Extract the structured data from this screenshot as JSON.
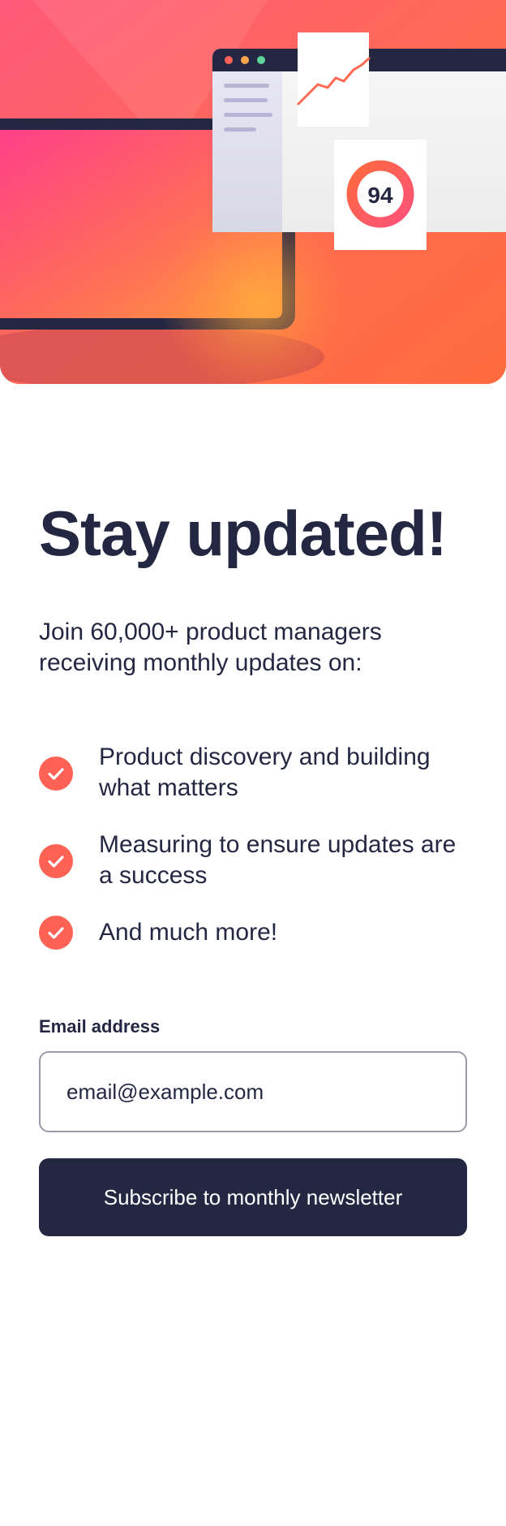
{
  "hero": {
    "score_value": "94",
    "illustration_name": "dashboard-illustration"
  },
  "main": {
    "headline": "Stay updated!",
    "intro": "Join 60,000+ product managers receiving monthly updates on:",
    "benefits": [
      {
        "icon": "check-circle-icon",
        "text": "Product discovery and building what matters"
      },
      {
        "icon": "check-circle-icon",
        "text": "Measuring to ensure updates are a success"
      },
      {
        "icon": "check-circle-icon",
        "text": "And much more!"
      }
    ]
  },
  "form": {
    "email_label": "Email address",
    "email_placeholder": "email@example.com",
    "email_value": "",
    "submit_label": "Subscribe to monthly newsletter"
  },
  "colors": {
    "navy": "#242742",
    "tomato": "#ff6155",
    "white": "#ffffff",
    "grey": "#9a9ba8"
  }
}
